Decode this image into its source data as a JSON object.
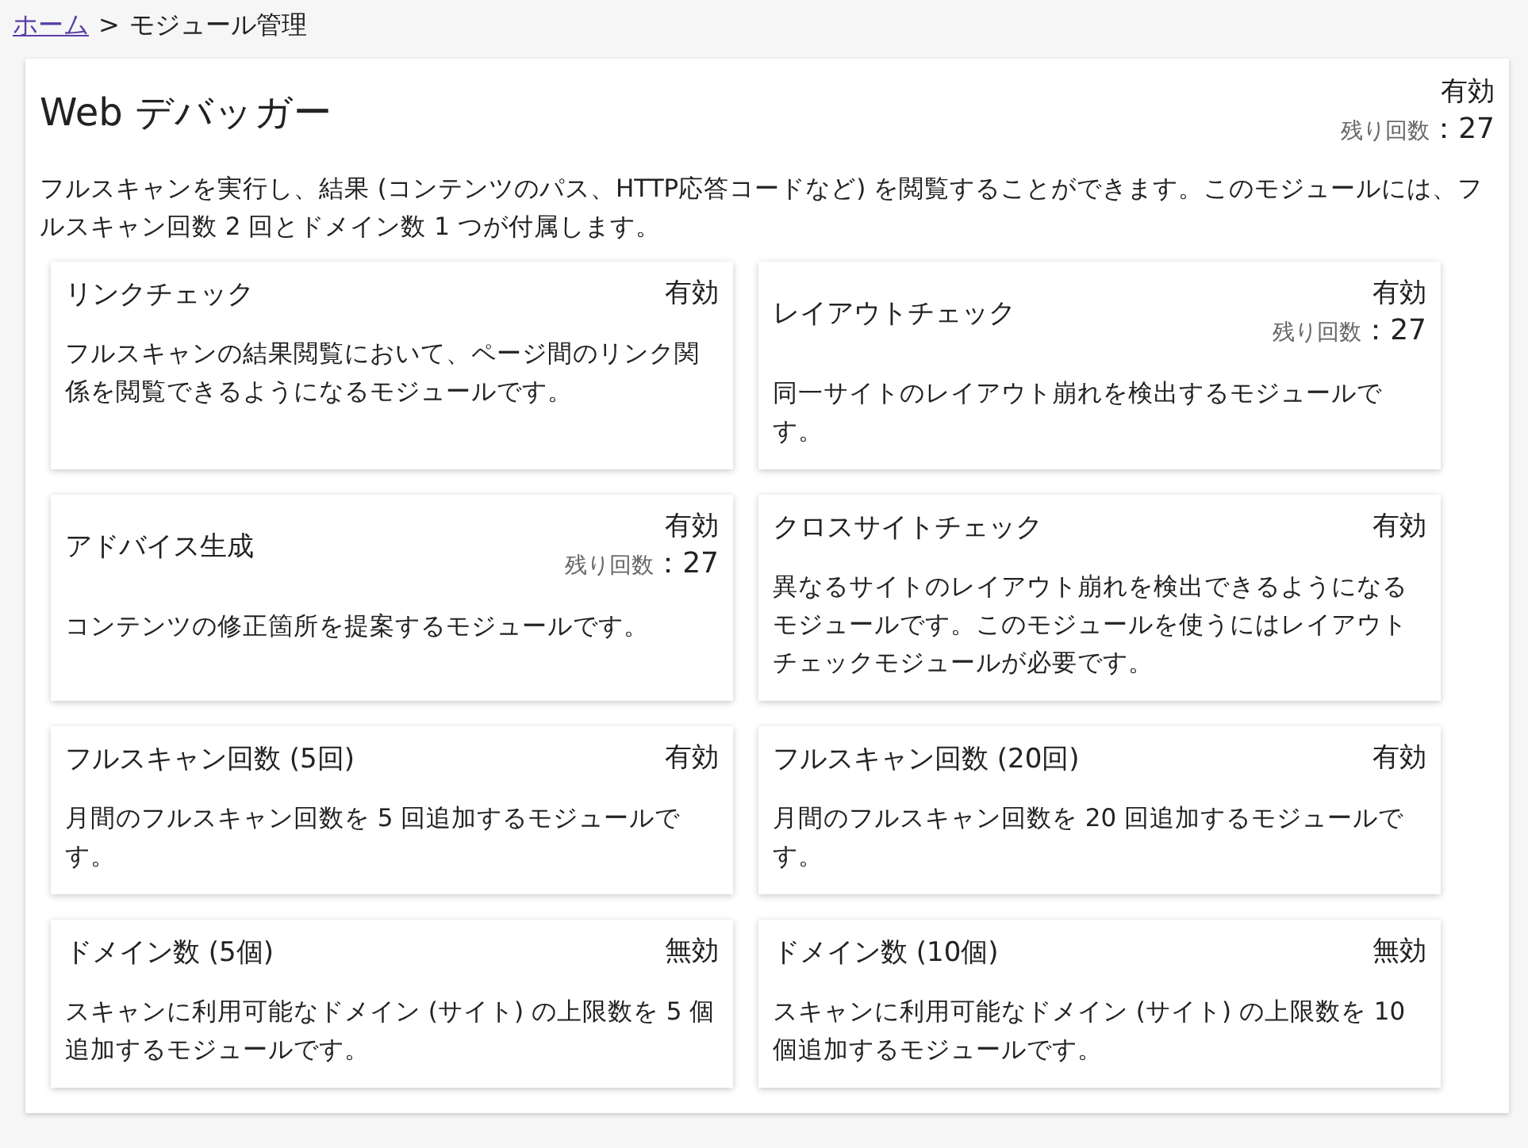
{
  "breadcrumb": {
    "link": "ホーム",
    "separator": ">",
    "current": "モジュール管理"
  },
  "module": {
    "title": "Web デバッガー",
    "status": "有効",
    "remaining_label": "残り回数",
    "remaining": "：27",
    "description": "フルスキャンを実行し、結果 (コンテンツのパス、HTTP応答コードなど) を閲覧することができます。このモジュールには、フルスキャン回数 2 回とドメイン数 1 つが付属します。"
  },
  "submodules": [
    {
      "title": "リンクチェック",
      "status": "有効",
      "description": "フルスキャンの結果閲覧において、ページ間のリンク関係を閲覧できるようになるモジュールです。"
    },
    {
      "title": "レイアウトチェック",
      "status": "有効",
      "remaining_label": "残り回数",
      "remaining": "：27",
      "description": "同一サイトのレイアウト崩れを検出するモジュールです。"
    },
    {
      "title": "アドバイス生成",
      "status": "有効",
      "remaining_label": "残り回数",
      "remaining": "：27",
      "description": "コンテンツの修正箇所を提案するモジュールです。"
    },
    {
      "title": "クロスサイトチェック",
      "status": "有効",
      "description": "異なるサイトのレイアウト崩れを検出できるようになるモジュールです。このモジュールを使うにはレイアウトチェックモジュールが必要です。"
    },
    {
      "title": "フルスキャン回数 (5回)",
      "status": "有効",
      "description": "月間のフルスキャン回数を 5 回追加するモジュールです。"
    },
    {
      "title": "フルスキャン回数 (20回)",
      "status": "有効",
      "description": "月間のフルスキャン回数を 20 回追加するモジュールです。"
    },
    {
      "title": "ドメイン数 (5個)",
      "status": "無効",
      "description": "スキャンに利用可能なドメイン (サイト) の上限数を 5 個追加するモジュールです。"
    },
    {
      "title": "ドメイン数 (10個)",
      "status": "無効",
      "description": "スキャンに利用可能なドメイン (サイト) の上限数を 10 個追加するモジュールです。"
    }
  ]
}
